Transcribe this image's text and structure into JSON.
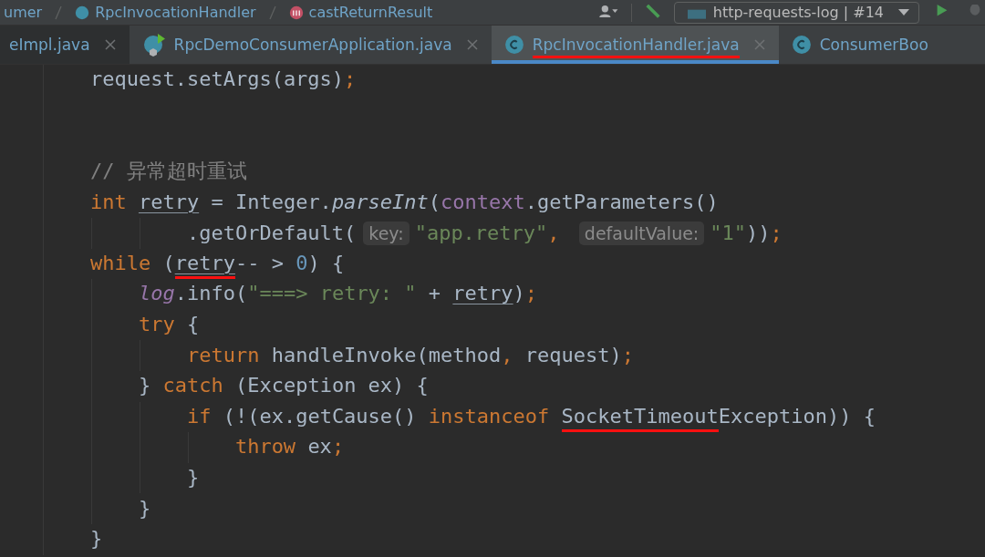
{
  "breadcrumbs": [
    {
      "label": "umer",
      "kind": "module"
    },
    {
      "label": "RpcInvocationHandler",
      "kind": "class"
    },
    {
      "label": "castReturnResult",
      "kind": "method"
    }
  ],
  "run_config": {
    "label": "http-requests-log | #14"
  },
  "tabs": [
    {
      "label": "eImpl.java",
      "kind": "file",
      "selected": false,
      "closable": true,
      "annotated": false
    },
    {
      "label": "RpcDemoConsumerApplication.java",
      "kind": "spring",
      "selected": false,
      "closable": true,
      "annotated": false
    },
    {
      "label": "RpcInvocationHandler.java",
      "kind": "class",
      "selected": true,
      "closable": true,
      "annotated": true
    },
    {
      "label": "ConsumerBoo",
      "kind": "class",
      "selected": false,
      "closable": false,
      "annotated": false
    }
  ],
  "code": [
    {
      "tokens": [
        {
          "text": "        request.setArgs(args)",
          "kind": "plain"
        },
        {
          "text": ";",
          "kind": "keyword"
        }
      ]
    },
    {
      "kind": "blank"
    },
    {
      "kind": "blank"
    },
    {
      "tokens": [
        {
          "text": "        // 异常超时重试",
          "kind": "comment"
        }
      ]
    },
    {
      "tokens": [
        {
          "text": "        int ",
          "kind": "keyword"
        },
        {
          "text": "retry",
          "kind": "variable"
        },
        {
          "text": " = Integer.",
          "kind": "plain"
        },
        {
          "text": "parseInt",
          "kind": "italic"
        },
        {
          "text": "(",
          "kind": "plain"
        },
        {
          "text": "context",
          "kind": "field"
        },
        {
          "text": ".getParameters()",
          "kind": "plain"
        }
      ]
    },
    {
      "tokens": [
        {
          "text": "                .getOrDefault(",
          "kind": "plain"
        },
        {
          "text": "key:",
          "kind": "hint"
        },
        {
          "text": "\"app.retry\"",
          "kind": "string"
        },
        {
          "text": ", ",
          "kind": "keyword"
        },
        {
          "text": "defaultValue:",
          "kind": "hint"
        },
        {
          "text": "\"1\"",
          "kind": "string"
        },
        {
          "text": "))",
          "kind": "plain"
        },
        {
          "text": ";",
          "kind": "keyword"
        }
      ]
    },
    {
      "tokens": [
        {
          "text": "        while ",
          "kind": "keyword"
        },
        {
          "text": "(",
          "kind": "plain"
        },
        {
          "text": "retry",
          "kind": "variable",
          "annotated": true
        },
        {
          "text": "-- > ",
          "kind": "plain"
        },
        {
          "text": "0",
          "kind": "number"
        },
        {
          "text": ") {",
          "kind": "plain"
        }
      ]
    },
    {
      "tokens": [
        {
          "text": "            log",
          "kind": "static"
        },
        {
          "text": ".info(",
          "kind": "plain"
        },
        {
          "text": "\"===> retry: \"",
          "kind": "string"
        },
        {
          "text": " + ",
          "kind": "plain"
        },
        {
          "text": "retry",
          "kind": "variable"
        },
        {
          "text": ")",
          "kind": "plain"
        },
        {
          "text": ";",
          "kind": "keyword"
        }
      ]
    },
    {
      "tokens": [
        {
          "text": "            try ",
          "kind": "keyword"
        },
        {
          "text": "{",
          "kind": "plain"
        }
      ]
    },
    {
      "tokens": [
        {
          "text": "                return ",
          "kind": "keyword"
        },
        {
          "text": "handleInvoke(method",
          "kind": "plain"
        },
        {
          "text": ", ",
          "kind": "keyword"
        },
        {
          "text": "request)",
          "kind": "plain"
        },
        {
          "text": ";",
          "kind": "keyword"
        }
      ]
    },
    {
      "tokens": [
        {
          "text": "            } ",
          "kind": "plain"
        },
        {
          "text": "catch ",
          "kind": "keyword"
        },
        {
          "text": "(Exception ex) {",
          "kind": "plain"
        }
      ]
    },
    {
      "tokens": [
        {
          "text": "                if ",
          "kind": "keyword"
        },
        {
          "text": "(!(ex.getCause() ",
          "kind": "plain"
        },
        {
          "text": "instanceof ",
          "kind": "keyword"
        },
        {
          "text": "SocketTimeout",
          "kind": "plain",
          "annotated": true
        },
        {
          "text": "Exception)) {",
          "kind": "plain"
        }
      ]
    },
    {
      "tokens": [
        {
          "text": "                    throw ",
          "kind": "keyword"
        },
        {
          "text": "ex",
          "kind": "plain"
        },
        {
          "text": ";",
          "kind": "keyword"
        }
      ]
    },
    {
      "tokens": [
        {
          "text": "                }",
          "kind": "plain"
        }
      ]
    },
    {
      "tokens": [
        {
          "text": "            }",
          "kind": "plain"
        }
      ]
    },
    {
      "tokens": [
        {
          "text": "        }",
          "kind": "plain"
        }
      ]
    }
  ]
}
